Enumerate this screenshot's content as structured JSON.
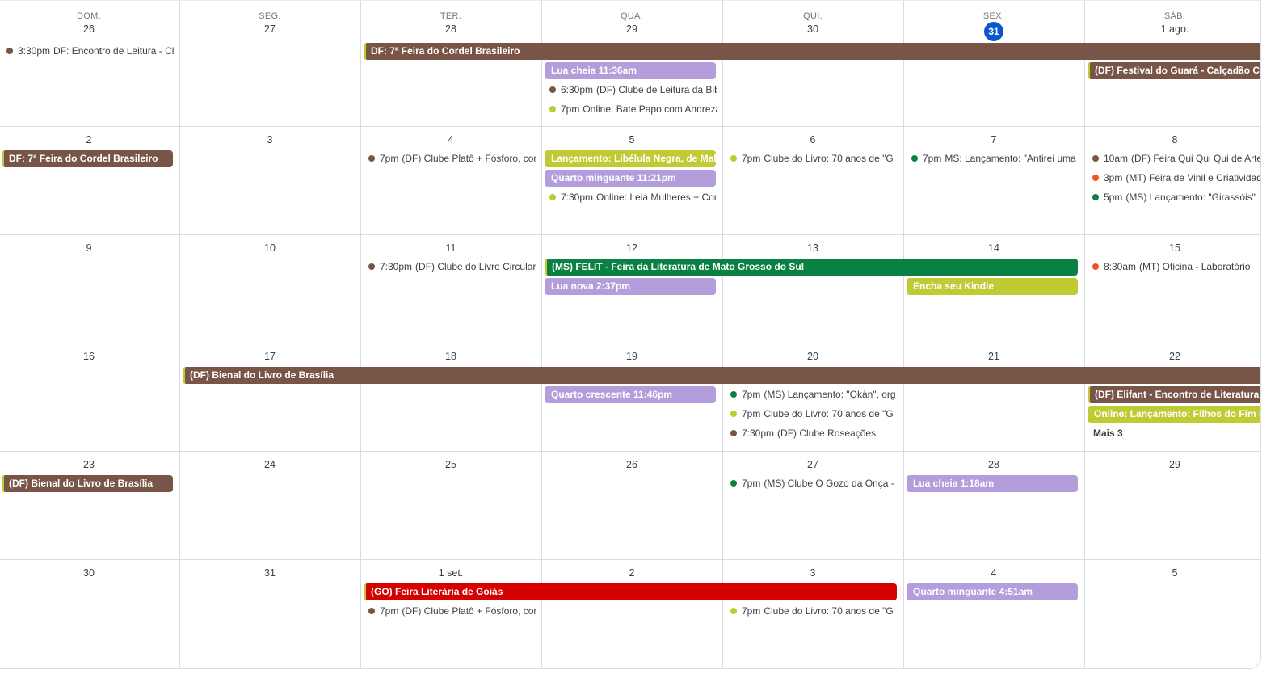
{
  "colors": {
    "brown": "#795548",
    "purple": "#b39ddb",
    "olive": "#c0ca33",
    "green": "#0b8043",
    "red": "#d50000",
    "orange": "#f4511e",
    "today": "#0b57d0"
  },
  "weekdays": [
    "DOM.",
    "SEG.",
    "TER.",
    "QUA.",
    "QUI.",
    "SEX.",
    "SÁB."
  ],
  "weeks": [
    [
      "26",
      "27",
      "28",
      "29",
      "30",
      "31",
      "1 ago."
    ],
    [
      "2",
      "3",
      "4",
      "5",
      "6",
      "7",
      "8"
    ],
    [
      "9",
      "10",
      "11",
      "12",
      "13",
      "14",
      "15"
    ],
    [
      "16",
      "17",
      "18",
      "19",
      "20",
      "21",
      "22"
    ],
    [
      "23",
      "24",
      "25",
      "26",
      "27",
      "28",
      "29"
    ],
    [
      "30",
      "31",
      "1 set.",
      "2",
      "3",
      "4",
      "5"
    ]
  ],
  "today": {
    "week": 0,
    "day": 5
  },
  "events": [
    {
      "kind": "timed",
      "week": 0,
      "day": 0,
      "slot": 0,
      "time": "3:30pm",
      "title": "DF: Encontro de Leitura - Clube",
      "color": "brown"
    },
    {
      "kind": "bar",
      "week": 0,
      "day": 2,
      "span": 5,
      "slot": 0,
      "title": "DF: 7ª Feira do Cordel Brasileiro",
      "color": "brown",
      "edge": true
    },
    {
      "kind": "bar",
      "week": 0,
      "day": 3,
      "span": 1,
      "slot": 1,
      "title": "Lua cheia 11:36am",
      "color": "purple"
    },
    {
      "kind": "bar",
      "week": 0,
      "day": 6,
      "span": 1,
      "slot": 1,
      "title": "(DF) Festival do Guará - Calçadão Cultural",
      "color": "brown",
      "edge": true
    },
    {
      "kind": "timed",
      "week": 0,
      "day": 3,
      "slot": 2,
      "time": "6:30pm",
      "title": "(DF) Clube de Leitura da Biblioteca",
      "color": "brown"
    },
    {
      "kind": "timed",
      "week": 0,
      "day": 3,
      "slot": 3,
      "time": "7pm",
      "title": "Online: Bate Papo com Andreza",
      "color": "olive"
    },
    {
      "kind": "bar",
      "week": 1,
      "day": 0,
      "span": 1,
      "slot": 0,
      "title": "DF: 7ª Feira do Cordel Brasileiro",
      "color": "brown",
      "edge": true
    },
    {
      "kind": "timed",
      "week": 1,
      "day": 2,
      "slot": 0,
      "time": "7pm",
      "title": "(DF) Clube Platô + Fósforo, com",
      "color": "brown"
    },
    {
      "kind": "bar",
      "week": 1,
      "day": 3,
      "span": 1,
      "slot": 0,
      "title": "Lançamento: Libélula Negra, de Mal",
      "color": "olive"
    },
    {
      "kind": "bar",
      "week": 1,
      "day": 3,
      "span": 1,
      "slot": 1,
      "title": "Quarto minguante 11:21pm",
      "color": "purple"
    },
    {
      "kind": "timed",
      "week": 1,
      "day": 3,
      "slot": 2,
      "time": "7:30pm",
      "title": "Online: Leia Mulheres + Com",
      "color": "olive"
    },
    {
      "kind": "timed",
      "week": 1,
      "day": 4,
      "slot": 0,
      "time": "7pm",
      "title": "Clube do Livro: 70 anos de \"G",
      "color": "olive"
    },
    {
      "kind": "timed",
      "week": 1,
      "day": 5,
      "slot": 0,
      "time": "7pm",
      "title": "MS: Lançamento: \"Antirei uma",
      "color": "green"
    },
    {
      "kind": "timed",
      "week": 1,
      "day": 6,
      "slot": 0,
      "time": "10am",
      "title": "(DF) Feira Qui Qui Qui de Arte",
      "color": "brown"
    },
    {
      "kind": "timed",
      "week": 1,
      "day": 6,
      "slot": 1,
      "time": "3pm",
      "title": "(MT) Feira de Vinil e Criatividade",
      "color": "orange"
    },
    {
      "kind": "timed",
      "week": 1,
      "day": 6,
      "slot": 2,
      "time": "5pm",
      "title": "(MS) Lançamento: \"Girassóis\"",
      "color": "green"
    },
    {
      "kind": "timed",
      "week": 2,
      "day": 2,
      "slot": 0,
      "time": "7:30pm",
      "title": "(DF) Clube do Livro Circular",
      "color": "brown"
    },
    {
      "kind": "bar",
      "week": 2,
      "day": 3,
      "span": 3,
      "slot": 0,
      "title": "(MS) FELIT - Feira da Literatura de Mato Grosso do Sul",
      "color": "green",
      "edge": true
    },
    {
      "kind": "bar",
      "week": 2,
      "day": 3,
      "span": 1,
      "slot": 1,
      "title": "Lua nova 2:37pm",
      "color": "purple"
    },
    {
      "kind": "bar",
      "week": 2,
      "day": 5,
      "span": 1,
      "slot": 1,
      "title": "Encha seu Kindle",
      "color": "olive"
    },
    {
      "kind": "timed",
      "week": 2,
      "day": 6,
      "slot": 0,
      "time": "8:30am",
      "title": "(MT) Oficina - Laboratório",
      "color": "orange"
    },
    {
      "kind": "bar",
      "week": 3,
      "day": 1,
      "span": 6,
      "slot": 0,
      "title": "(DF) Bienal do Livro de Brasília",
      "color": "brown",
      "edge": true
    },
    {
      "kind": "bar",
      "week": 3,
      "day": 3,
      "span": 1,
      "slot": 1,
      "title": "Quarto crescente 11:46pm",
      "color": "purple"
    },
    {
      "kind": "timed",
      "week": 3,
      "day": 4,
      "slot": 1,
      "time": "7pm",
      "title": "(MS) Lançamento: \"Ọkàn\", org",
      "color": "green"
    },
    {
      "kind": "timed",
      "week": 3,
      "day": 4,
      "slot": 2,
      "time": "7pm",
      "title": "Clube do Livro: 70 anos de \"G",
      "color": "olive"
    },
    {
      "kind": "timed",
      "week": 3,
      "day": 4,
      "slot": 3,
      "time": "7:30pm",
      "title": "(DF) Clube Roseações",
      "color": "brown"
    },
    {
      "kind": "bar",
      "week": 3,
      "day": 6,
      "span": 1,
      "slot": 1,
      "title": "(DF) Elifant - Encontro de Literatura",
      "color": "brown",
      "edge": true
    },
    {
      "kind": "bar",
      "week": 3,
      "day": 6,
      "span": 1,
      "slot": 2,
      "title": "Online: Lançamento: Filhos do Fim do",
      "color": "olive"
    },
    {
      "kind": "more",
      "week": 3,
      "day": 6,
      "slot": 3,
      "title": "Mais 3"
    },
    {
      "kind": "bar",
      "week": 4,
      "day": 0,
      "span": 1,
      "slot": 0,
      "title": "(DF) Bienal do Livro de Brasília",
      "color": "brown",
      "edge": true
    },
    {
      "kind": "timed",
      "week": 4,
      "day": 4,
      "slot": 0,
      "time": "7pm",
      "title": "(MS) Clube O Gozo da Onça - ",
      "color": "green"
    },
    {
      "kind": "bar",
      "week": 4,
      "day": 5,
      "span": 1,
      "slot": 0,
      "title": "Lua cheia 1:18am",
      "color": "purple"
    },
    {
      "kind": "bar",
      "week": 5,
      "day": 2,
      "span": 3,
      "slot": 0,
      "title": "(GO) Feira Literária de Goiás",
      "color": "red",
      "edge": true
    },
    {
      "kind": "bar",
      "week": 5,
      "day": 5,
      "span": 1,
      "slot": 0,
      "title": "Quarto minguante 4:51am",
      "color": "purple"
    },
    {
      "kind": "timed",
      "week": 5,
      "day": 2,
      "slot": 1,
      "time": "7pm",
      "title": "(DF) Clube Platô + Fósforo, com",
      "color": "brown"
    },
    {
      "kind": "timed",
      "week": 5,
      "day": 4,
      "slot": 1,
      "time": "7pm",
      "title": "Clube do Livro: 70 anos de \"G",
      "color": "olive"
    }
  ]
}
